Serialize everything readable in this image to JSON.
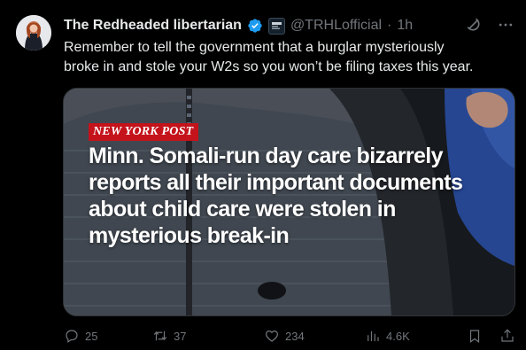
{
  "author": {
    "display_name": "The Redheaded libertarian",
    "handle": "@TRHLofficial",
    "separator": "·",
    "time": "1h",
    "avatar": "avatar-photo",
    "verified_color": "#1d9bf0"
  },
  "tweet": {
    "text": "Remember to tell the government that a burglar mysteriously\nbroke in and stole your W2s so you won’t be filing taxes this year."
  },
  "media": {
    "source_tag": "NEW YORK POST",
    "headline": "Minn. Somali-run day care bizarrely\nreports all their important documents\nabout child care were stolen in\nmysterious break-in",
    "tag_color": "#c4131b"
  },
  "actions": {
    "replies": "25",
    "reposts": "37",
    "likes": "234",
    "views": "4.6K",
    "bookmark_icon": "bookmark-icon",
    "share_icon": "share-icon"
  },
  "header_icons": [
    "grok-icon",
    "more-icon"
  ]
}
